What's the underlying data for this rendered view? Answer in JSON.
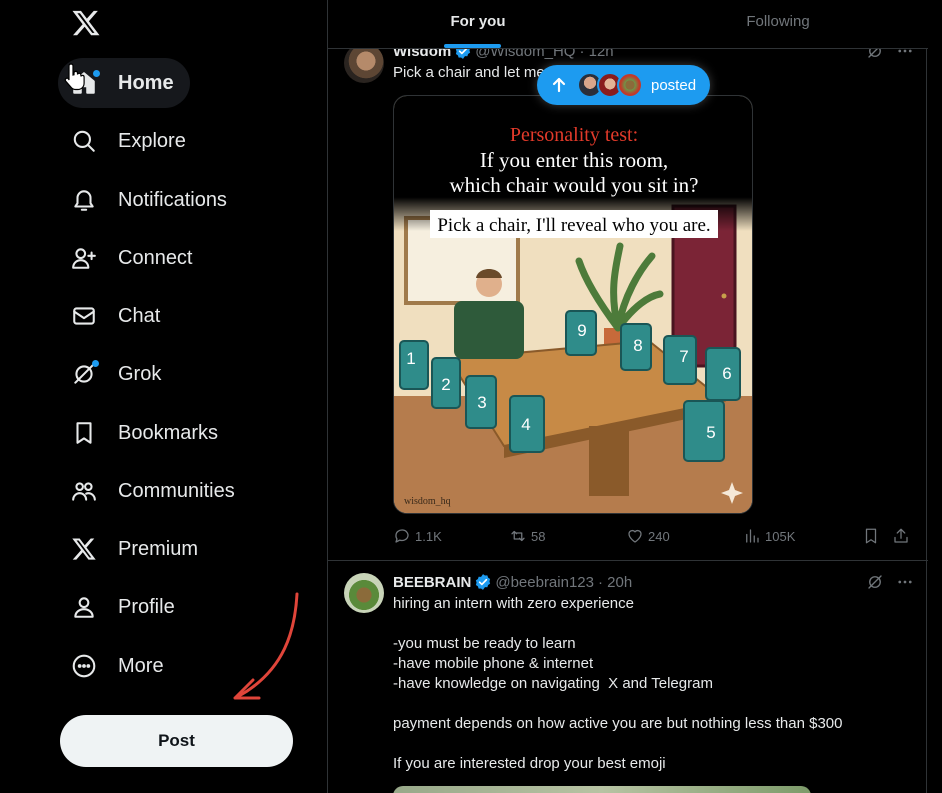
{
  "sidebar": {
    "logo": "x-logo-icon",
    "items": [
      {
        "label": "Home",
        "icon": "home-icon",
        "active": true,
        "dot": true
      },
      {
        "label": "Explore",
        "icon": "search-icon"
      },
      {
        "label": "Notifications",
        "icon": "bell-icon"
      },
      {
        "label": "Connect",
        "icon": "person-plus-icon"
      },
      {
        "label": "Chat",
        "icon": "envelope-icon"
      },
      {
        "label": "Grok",
        "icon": "grok-icon",
        "dot": true
      },
      {
        "label": "Bookmarks",
        "icon": "bookmark-icon"
      },
      {
        "label": "Communities",
        "icon": "people-icon"
      },
      {
        "label": "Premium",
        "icon": "x-logo-icon"
      },
      {
        "label": "Profile",
        "icon": "person-icon"
      },
      {
        "label": "More",
        "icon": "more-circle-icon"
      }
    ],
    "post_button": "Post"
  },
  "tabs": [
    {
      "label": "For you",
      "active": true
    },
    {
      "label": "Following",
      "active": false
    }
  ],
  "posted_pill": {
    "label": "posted"
  },
  "tweets": [
    {
      "name": "Wisdom",
      "handle": "@Wisdom_HQ",
      "time": "· 12h",
      "text": "Pick a chair and let me",
      "media": {
        "headline": "Personality test:",
        "question_line1": "If you enter this room,",
        "question_line2": "which chair would you sit in?",
        "caption": "Pick a chair, I'll reveal who you are.",
        "watermark": "wisdom_hq",
        "chair_numbers": [
          "1",
          "2",
          "3",
          "4",
          "5",
          "6",
          "7",
          "8",
          "9"
        ]
      },
      "stats": {
        "replies": "1.1K",
        "reposts": "58",
        "likes": "240",
        "views": "105K"
      }
    },
    {
      "name": "BEEBRAIN",
      "handle": "@beebrain123",
      "time": "· 20h",
      "lines": [
        "hiring an intern with zero experience",
        "",
        "-you must be ready to learn",
        "-have mobile phone & internet",
        "-have knowledge on navigating  X and Telegram",
        "",
        "payment depends on how active you are but nothing less than $300",
        "",
        "If you are interested drop your best emoji"
      ]
    }
  ],
  "colors": {
    "accent": "#1d9bf0",
    "background": "#000000",
    "text": "#e7e9ea",
    "muted": "#71767b",
    "annotation_arrow": "#e0453a"
  }
}
